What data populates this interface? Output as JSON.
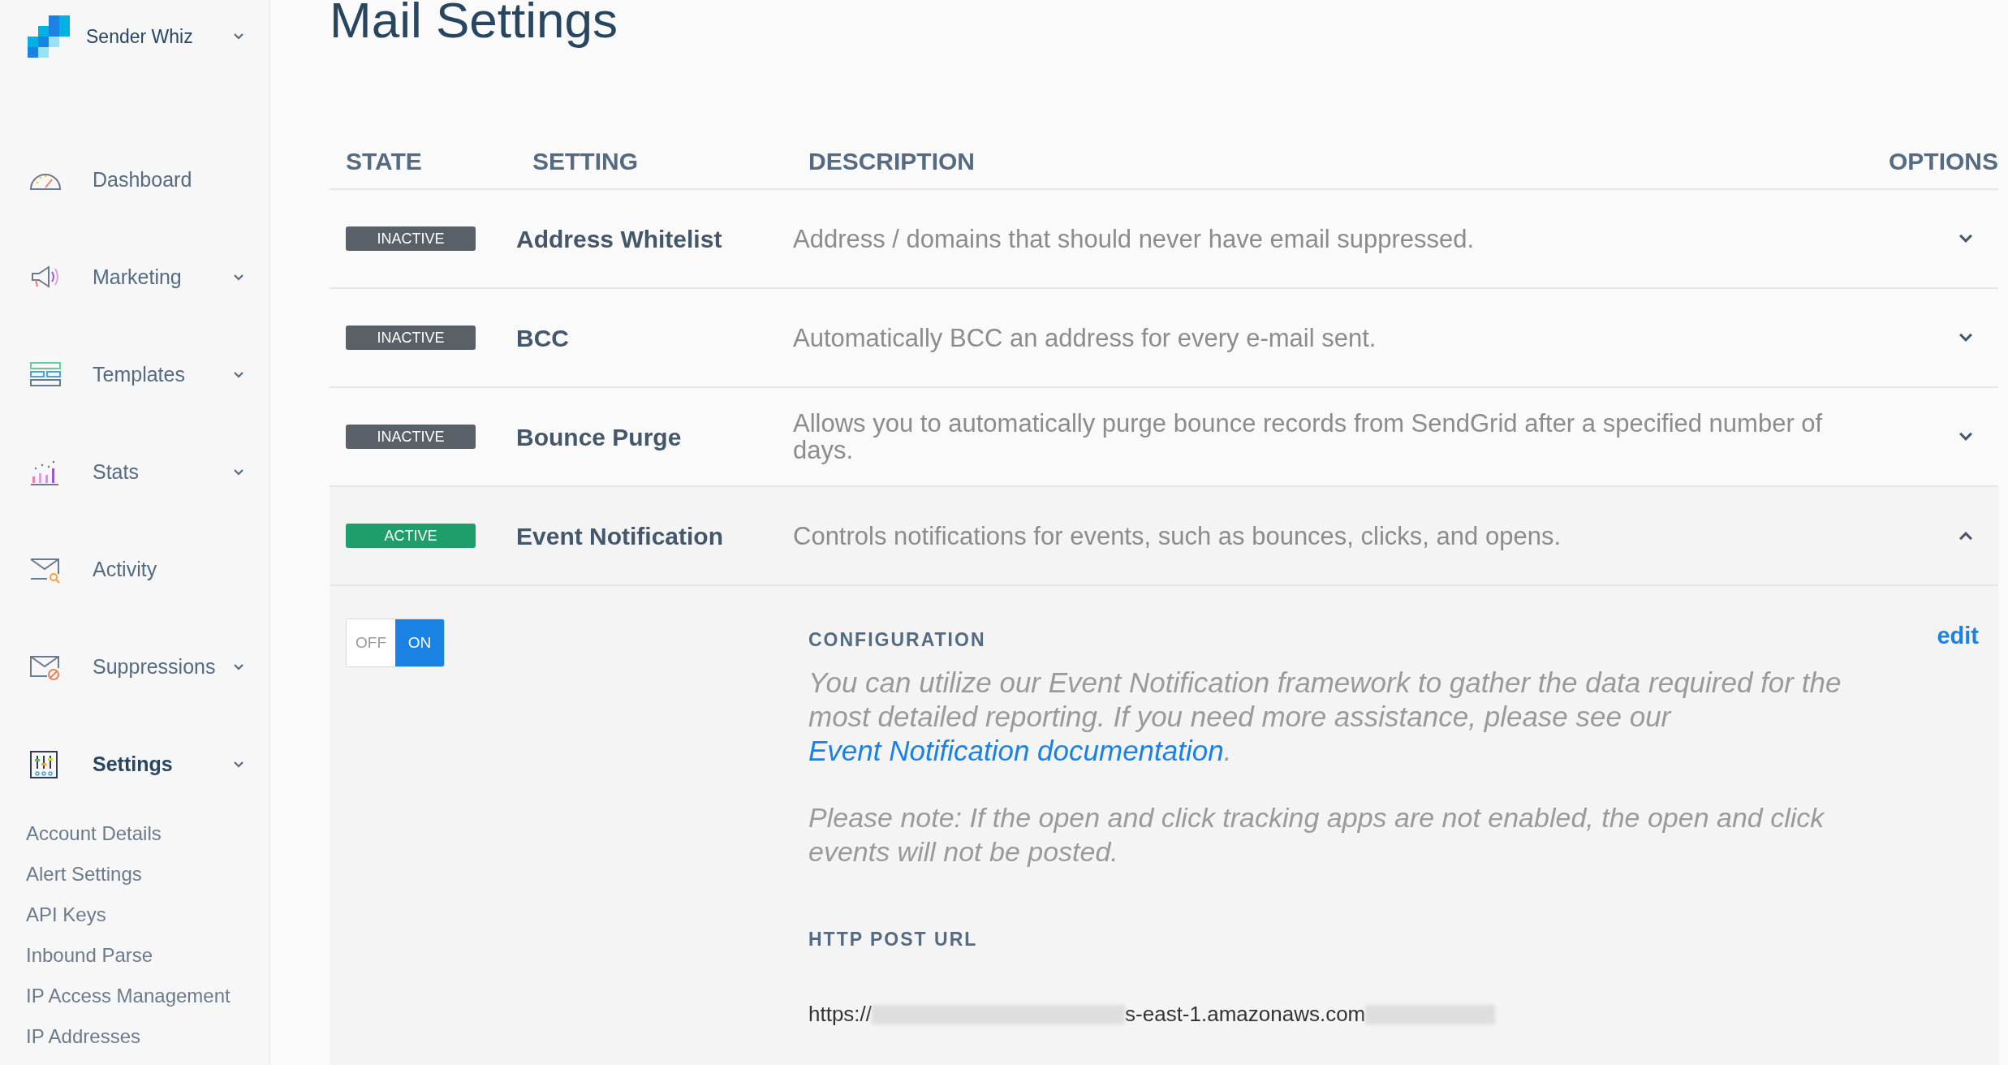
{
  "app": {
    "name": "Sender Whiz"
  },
  "sidebar": {
    "items": [
      {
        "label": "Dashboard",
        "expandable": false,
        "selected": false
      },
      {
        "label": "Marketing",
        "expandable": true,
        "selected": false
      },
      {
        "label": "Templates",
        "expandable": true,
        "selected": false
      },
      {
        "label": "Stats",
        "expandable": true,
        "selected": false
      },
      {
        "label": "Activity",
        "expandable": false,
        "selected": false
      },
      {
        "label": "Suppressions",
        "expandable": true,
        "selected": false
      },
      {
        "label": "Settings",
        "expandable": true,
        "selected": true
      }
    ],
    "sub_items": [
      "Account Details",
      "Alert Settings",
      "API Keys",
      "Inbound Parse",
      "IP Access Management",
      "IP Addresses"
    ]
  },
  "page": {
    "title": "Mail Settings"
  },
  "table": {
    "columns": [
      "STATE",
      "SETTING",
      "DESCRIPTION",
      "OPTIONS"
    ],
    "rows": [
      {
        "state": "INACTIVE",
        "active": false,
        "setting": "Address Whitelist",
        "description": "Address / domains that should never have email suppressed.",
        "expanded": false
      },
      {
        "state": "INACTIVE",
        "active": false,
        "setting": "BCC",
        "description": "Automatically BCC an address for every e-mail sent.",
        "expanded": false
      },
      {
        "state": "INACTIVE",
        "active": false,
        "setting": "Bounce Purge",
        "description": "Allows you to automatically purge bounce records from SendGrid after a specified number of days.",
        "expanded": false
      },
      {
        "state": "ACTIVE",
        "active": true,
        "setting": "Event Notification",
        "description": "Controls notifications for events, such as bounces, clicks, and opens.",
        "expanded": true
      }
    ]
  },
  "detail": {
    "toggle": {
      "off_label": "OFF",
      "on_label": "ON",
      "on": true
    },
    "heading": "CONFIGURATION",
    "edit": "edit",
    "intro": "You can utilize our Event Notification framework to gather the data required for the most detailed reporting. If you need more assistance, please see our",
    "link": "Event Notification documentation",
    "intro_end": ".",
    "note": "Please note: If the open and click tracking apps are not enabled, the open and click events will not be posted.",
    "url_heading": "HTTP POST URL",
    "url_start": "https://",
    "url_middle": "s-east-1.amazonaws.com"
  }
}
